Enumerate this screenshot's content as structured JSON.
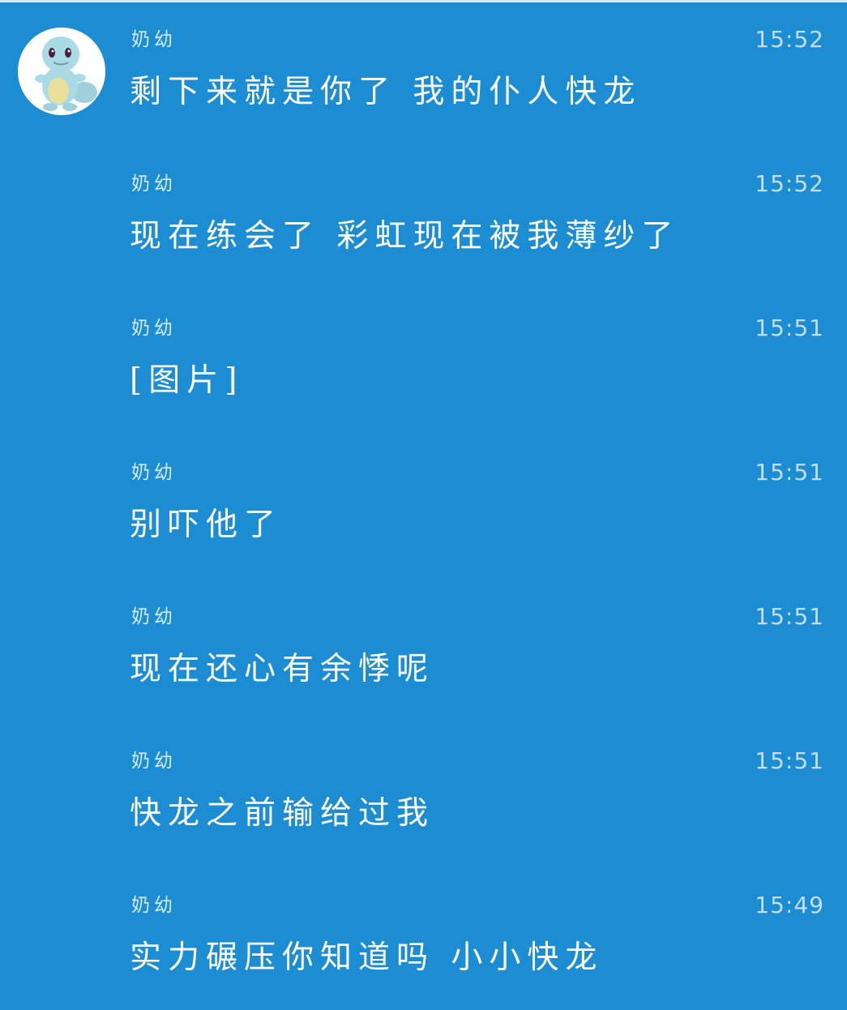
{
  "colors": {
    "background": "#1c8dd2",
    "message_text": "#ffffff",
    "meta_text": "#c4def0"
  },
  "messages": [
    {
      "sender": "奶幼",
      "time": "15:52",
      "text": "剩下来就是你了 我的仆人快龙",
      "avatar_icon": "squirtle-avatar-icon"
    },
    {
      "sender": "奶幼",
      "time": "15:52",
      "text": "现在练会了 彩虹现在被我薄纱了"
    },
    {
      "sender": "奶幼",
      "time": "15:51",
      "text": "[图片]"
    },
    {
      "sender": "奶幼",
      "time": "15:51",
      "text": "别吓他了"
    },
    {
      "sender": "奶幼",
      "time": "15:51",
      "text": "现在还心有余悸呢"
    },
    {
      "sender": "奶幼",
      "time": "15:51",
      "text": "快龙之前输给过我"
    },
    {
      "sender": "奶幼",
      "time": "15:49",
      "text": "实力碾压你知道吗 小小快龙"
    }
  ]
}
